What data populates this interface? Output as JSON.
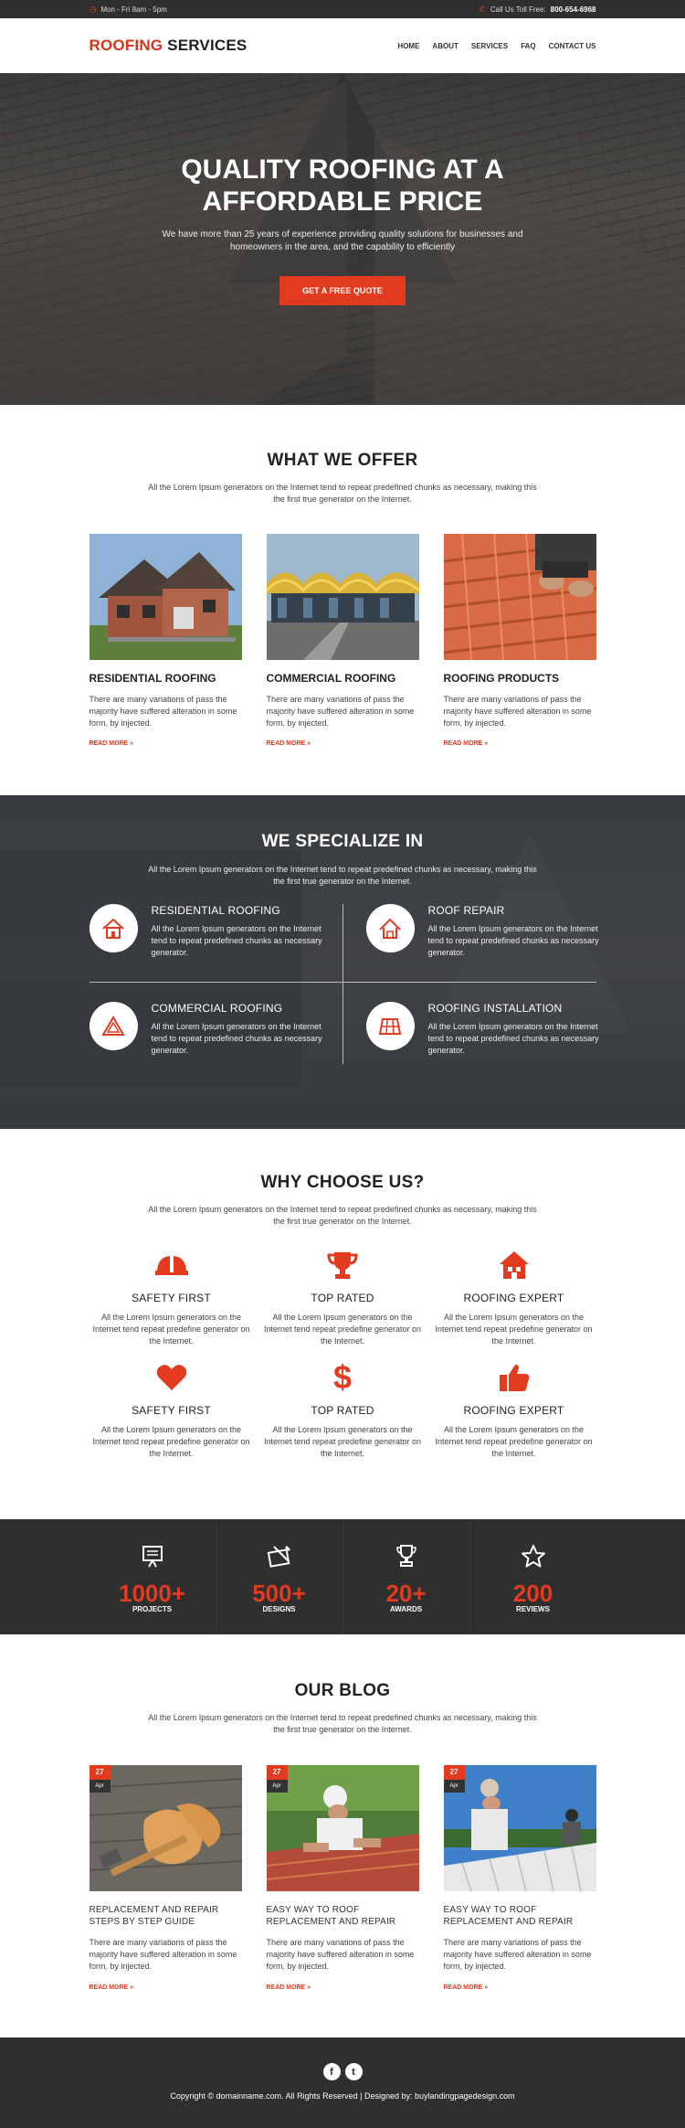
{
  "topbar": {
    "hours": "Mon - Fri 8am - 5pm",
    "toll_label": "Call Us Toll Free:",
    "phone": "800-654-6968"
  },
  "header": {
    "logo_accent": "ROOFING",
    "logo_rest": "SERVICES",
    "nav": [
      "HOME",
      "ABOUT",
      "SERVICES",
      "FAQ",
      "CONTACT US"
    ]
  },
  "hero": {
    "title_line1": "QUALITY ROOFING AT A",
    "title_line2": "AFFORDABLE PRICE",
    "text": "We have more than 25 years of experience providing quality solutions for businesses and homeowners in the area, and the capability to efficiently",
    "button": "GET A FREE QUOTE"
  },
  "offer": {
    "title": "WHAT WE OFFER",
    "subtitle": "All the Lorem Ipsum generators on the Internet tend to repeat predefined chunks as necessary, making this the first true generator on the Internet.",
    "cards": [
      {
        "title": "RESIDENTIAL ROOFING",
        "text": "There are many variations of pass the majority have suffered alteration in some form, by injected.",
        "link": "READ MORE »"
      },
      {
        "title": "COMMERCIAL ROOFING",
        "text": "There are many variations of pass the majority have suffered alteration in some form, by injected.",
        "link": "READ MORE »"
      },
      {
        "title": "ROOFING PRODUCTS",
        "text": "There are many variations of pass the majority have suffered alteration in some form, by injected.",
        "link": "READ MORE »"
      }
    ]
  },
  "specialize": {
    "title": "WE SPECIALIZE IN",
    "subtitle": "All the Lorem Ipsum generators on the Internet tend to repeat predefined chunks as necessary, making this the first true generator on the Internet.",
    "items": [
      {
        "title": "RESIDENTIAL ROOFING",
        "text": "All the Lorem Ipsum generators on the Internet tend to repeat predefined chunks as necessary generator."
      },
      {
        "title": "ROOF REPAIR",
        "text": "All the Lorem Ipsum generators on the Internet tend to repeat predefined chunks as necessary generator."
      },
      {
        "title": "COMMERCIAL ROOFING",
        "text": "All the Lorem Ipsum generators on the Internet tend to repeat predefined chunks as necessary generator."
      },
      {
        "title": "ROOFING INSTALLATION",
        "text": "All the Lorem Ipsum generators on the Internet tend to repeat predefined chunks as necessary generator."
      }
    ]
  },
  "why": {
    "title": "WHY CHOOSE US?",
    "subtitle": "All the Lorem Ipsum generators on the Internet tend to repeat predefined chunks as necessary, making this the first true generator on the Internet.",
    "items": [
      {
        "title": "SAFETY FIRST",
        "text": "All the Lorem Ipsum generators on the Internet tend repeat predefine generator on the Internet.",
        "icon": "helmet-icon"
      },
      {
        "title": "TOP RATED",
        "text": "All the Lorem Ipsum generators on the Internet tend repeat predefine generator on the Internet.",
        "icon": "trophy-icon"
      },
      {
        "title": "ROOFING EXPERT",
        "text": "All the Lorem Ipsum generators on the Internet tend repeat predefine generator on the Internet.",
        "icon": "house-icon"
      },
      {
        "title": "SAFETY FIRST",
        "text": "All the Lorem Ipsum generators on the Internet tend repeat predefine generator on the Internet.",
        "icon": "heart-icon"
      },
      {
        "title": "TOP RATED",
        "text": "All the Lorem Ipsum generators on the Internet tend repeat predefine generator on the Internet.",
        "icon": "dollar-icon"
      },
      {
        "title": "ROOFING EXPERT",
        "text": "All the Lorem Ipsum generators on the Internet tend repeat predefine generator on the Internet.",
        "icon": "thumbs-up-icon"
      }
    ]
  },
  "stats": [
    {
      "num": "1000+",
      "label": "PROJECTS"
    },
    {
      "num": "500+",
      "label": "DESIGNS"
    },
    {
      "num": "20+",
      "label": "AWARDS"
    },
    {
      "num": "200",
      "label": "REVIEWS"
    }
  ],
  "blog": {
    "title": "OUR BLOG",
    "subtitle": "All the Lorem Ipsum generators on the Internet tend to repeat predefined chunks as necessary, making this the first true generator on the Internet.",
    "posts": [
      {
        "day": "27",
        "month": "Apr",
        "title": "REPLACEMENT AND REPAIR STEPS BY STEP GUIDE",
        "text": "There are many variations of pass the majority have suffered alteration in some form, by injected.",
        "link": "READ MORE »"
      },
      {
        "day": "27",
        "month": "Apr",
        "title": "EASY WAY TO ROOF REPLACEMENT AND REPAIR",
        "text": "There are many variations of pass the majority have suffered alteration in some form, by injected.",
        "link": "READ MORE »"
      },
      {
        "day": "27",
        "month": "Apr",
        "title": "EASY WAY TO ROOF REPLACEMENT AND REPAIR",
        "text": "There are many variations of pass the majority have suffered alteration in some form, by injected.",
        "link": "READ MORE »"
      }
    ]
  },
  "footer": {
    "social": [
      "f",
      "t"
    ],
    "copyright": "Copyright © domainname.com. All Rights Reserved  |  Designed by: buylandingpagedesign.com"
  },
  "colors": {
    "accent": "#e23b1f",
    "dark": "#2f2f2f"
  }
}
